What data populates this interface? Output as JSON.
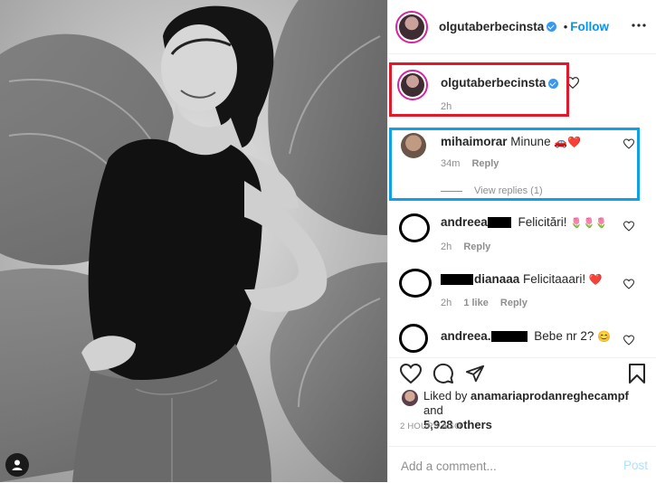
{
  "header": {
    "username": "olgutaberbecinsta",
    "follow_label": "Follow"
  },
  "caption": {
    "username": "olgutaberbecinsta",
    "time": "2h"
  },
  "comments": [
    {
      "username": "mihaimorar",
      "text": "Minune",
      "emoji": "🚗❤️",
      "time": "34m",
      "reply": "Reply",
      "view_replies": "View replies (1)"
    },
    {
      "username": "andreea",
      "text": "Felicitări!",
      "emoji": "🌷🌷🌷",
      "time": "2h",
      "reply": "Reply"
    },
    {
      "username": "dianaaa",
      "text": "Felicitaaari!",
      "emoji": "❤️",
      "time": "2h",
      "likes": "1 like",
      "reply": "Reply"
    },
    {
      "username": "andreea.",
      "text": "Bebe nr 2?",
      "emoji": "😊"
    }
  ],
  "likes": {
    "prefix": "Liked by",
    "user": "anamariaprodanreghecampf",
    "joiner": "and",
    "count": "5,928 others"
  },
  "timestamp": "2 HOURS AGO",
  "add_comment": {
    "placeholder": "Add a comment...",
    "post_label": "Post"
  },
  "colors": {
    "accent": "#0095f6",
    "highlight_red": "#e11a2b",
    "highlight_blue": "#0ea1e6",
    "heart": "#ed4956"
  },
  "icons": [
    "heart-icon",
    "comment-icon",
    "share-icon",
    "bookmark-icon",
    "verified-badge-icon",
    "user-tag-icon"
  ]
}
